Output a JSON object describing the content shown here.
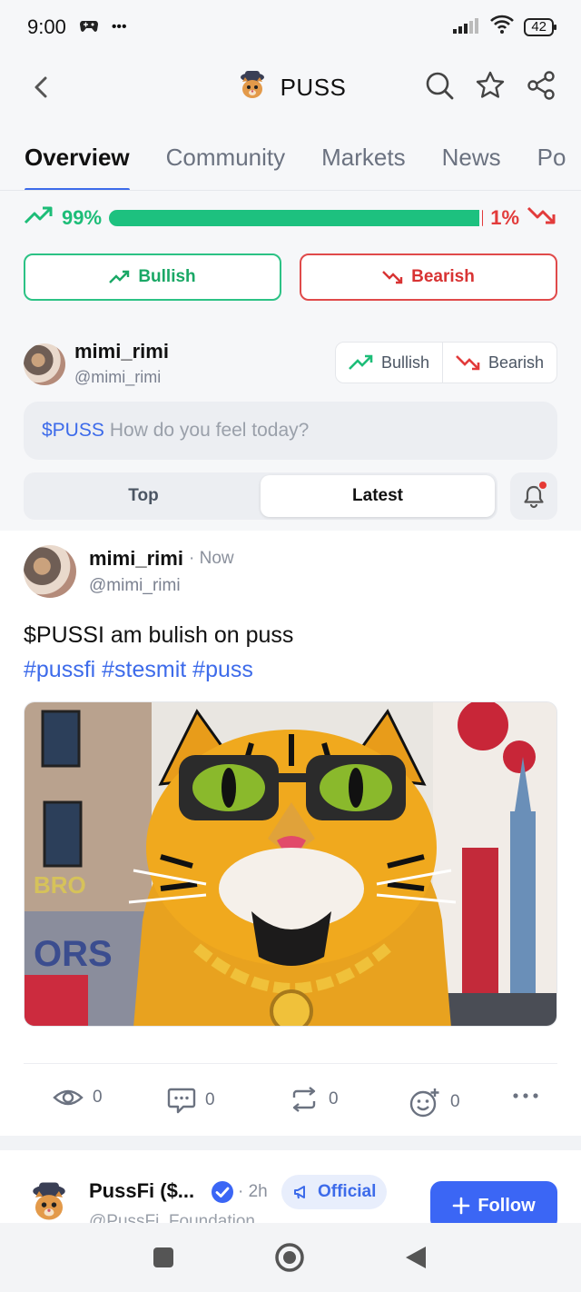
{
  "status_bar": {
    "time": "9:00",
    "dots": "•••",
    "battery": "42"
  },
  "header": {
    "title": "PUSS"
  },
  "tabs": [
    "Overview",
    "Community",
    "Markets",
    "News",
    "Po"
  ],
  "sentiment": {
    "bull_pct_label": "99%",
    "bear_pct_label": "1%",
    "bull_fraction": 0.99
  },
  "vote": {
    "bullish_label": "Bullish",
    "bearish_label": "Bearish"
  },
  "composer": {
    "name": "mimi_rimi",
    "handle": "@mimi_rimi",
    "mini_bull": "Bullish",
    "mini_bear": "Bearish",
    "ticker": "$PUSS",
    "placeholder": "How do you feel today?"
  },
  "sort": {
    "top": "Top",
    "latest": "Latest"
  },
  "post": {
    "name": "mimi_rimi",
    "time": "· Now",
    "handle": "@mimi_rimi",
    "text": "$PUSSI am bulish on puss",
    "tags": "#pussfi #stesmit #puss",
    "views": "0",
    "comments": "0",
    "reposts": "0",
    "reactions": "0"
  },
  "post2": {
    "name": "PussFi ($...",
    "time": "· 2h",
    "official": "Official",
    "handle": "@PussFi_Foundation",
    "follow": "Follow"
  },
  "colors": {
    "bull": "#1dc17f",
    "bear": "#e23b3b",
    "accent": "#3d6bea"
  }
}
